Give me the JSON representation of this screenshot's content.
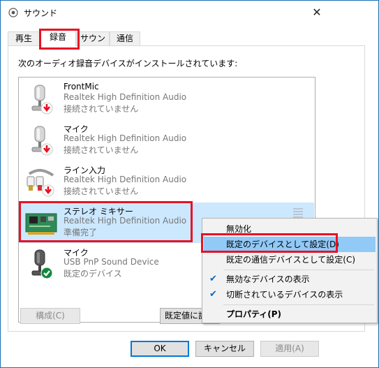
{
  "window": {
    "title": "サウンド"
  },
  "tabs": [
    {
      "label": "再生"
    },
    {
      "label": "録音"
    },
    {
      "label": "サウンド"
    },
    {
      "label": "通信"
    }
  ],
  "panel": {
    "description": "次のオーディオ録音デバイスがインストールされています:"
  },
  "devices": [
    {
      "name": "FrontMic",
      "description": "Realtek High Definition Audio",
      "status": "接続されていません",
      "icon": "microphone-icon"
    },
    {
      "name": "マイク",
      "description": "Realtek High Definition Audio",
      "status": "接続されていません",
      "icon": "microphone-icon"
    },
    {
      "name": "ライン入力",
      "description": "Realtek High Definition Audio",
      "status": "接続されていません",
      "icon": "line-in-cable-icon"
    },
    {
      "name": "ステレオ ミキサー",
      "description": "Realtek High Definition Audio",
      "status": "準備完了",
      "icon": "sound-card-icon"
    },
    {
      "name": "マイク",
      "description": "USB PnP Sound Device",
      "status": "既定のデバイス",
      "icon": "microphone-icon"
    }
  ],
  "buttons": {
    "configure": "構成(C)",
    "set_default": "既定値に設定",
    "ok": "OK",
    "cancel": "キャンセル",
    "apply": "適用(A)"
  },
  "context_menu": {
    "items": [
      {
        "label": "無効化"
      },
      {
        "label": "既定のデバイスとして設定(D)"
      },
      {
        "label": "既定の通信デバイスとして設定(C)"
      },
      {
        "label": "無効なデバイスの表示"
      },
      {
        "label": "切断されているデバイスの表示"
      },
      {
        "label": "プロパティ(P)"
      }
    ]
  },
  "colors": {
    "accent": "#0078d7",
    "highlight_box": "#e81123",
    "selected_row": "#cce8ff",
    "menu_hover": "#91c9f7"
  }
}
